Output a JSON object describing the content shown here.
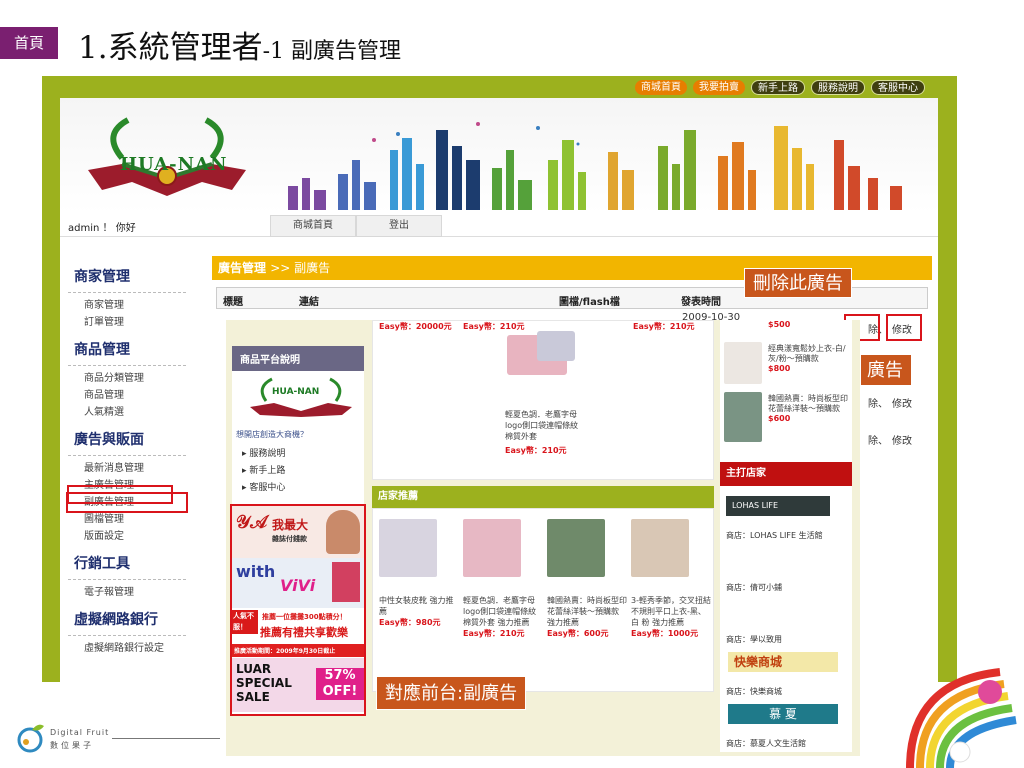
{
  "slide": {
    "home_tag": "首頁",
    "title_main": "1.系統管理者",
    "title_sub": "-1 副廣告管理"
  },
  "topnav": [
    "商城首頁",
    "我要拍賣",
    "新手上路",
    "服務說明",
    "客服中心"
  ],
  "logo_text": "HUA-NAN",
  "login": {
    "greeting": "admin ！ 你好",
    "tabs": [
      "商城首頁",
      "登出"
    ]
  },
  "sidebar": [
    {
      "title": "商家管理",
      "items": [
        "商家管理",
        "訂單管理"
      ]
    },
    {
      "title": "商品管理",
      "items": [
        "商品分類管理",
        "商品管理",
        "人氣精選"
      ]
    },
    {
      "title": "廣告與販面",
      "items": [
        "最新消息管理",
        "主廣告管理",
        "副廣告管理",
        "圖檔管理",
        "版面設定"
      ]
    },
    {
      "title": "行銷工具",
      "items": [
        "電子報管理"
      ]
    },
    {
      "title": "虛擬網路銀行",
      "items": [
        "虛擬網路銀行設定"
      ]
    }
  ],
  "ad_panel": {
    "title": "廣告管理",
    "crumb": ">> 副廣告",
    "columns": [
      "標題",
      "連結",
      "圖檔/flash檔",
      "發表時間"
    ],
    "date_fragment": "2009-10-30",
    "row_actions": [
      "除、",
      "修改",
      "除、",
      "修改",
      "除、",
      "修改"
    ]
  },
  "callouts": {
    "delete": "刪除此廣告",
    "ad_partial": "廣告",
    "front": "對應前台:副廣告"
  },
  "storefront": {
    "sidebar_title": "商品平台說明",
    "sidebar_logo": "HUA-NAN",
    "sidebar_question": "想開店創造大商機？",
    "sidebar_links": [
      "服務說明",
      "新手上路",
      "客服中心"
    ],
    "top_prices": [
      "Easy幣：20000元",
      "Easy幣：210元",
      "Easy幣：210元"
    ],
    "mid_product": {
      "desc": "輕夏色調．老鷹字母 logo側口袋連帽條紋 棉質外套",
      "price": "Easy幣：210元"
    },
    "store_title": "店家推薦",
    "products": [
      {
        "desc": "中性女裝皮靴 強力推薦",
        "price": "Easy幣：980元"
      },
      {
        "desc": "輕夏色調．老鷹字母 logo側口袋連帽條紋 棉質外套 強力推薦",
        "price": "Easy幣：210元"
      },
      {
        "desc": "韓國熱賣：時尚板型印 花蕾絲洋裝～預購款 強力推薦",
        "price": "Easy幣：600元"
      },
      {
        "desc": "3-輕秀季節，交叉扭結 不規則平口上衣-黑、 白 粉 強力推薦",
        "price": "Easy幣：1000元"
      }
    ],
    "right_items": [
      {
        "desc": "",
        "price": "$500"
      },
      {
        "desc": "經典漾寬鬆妙上衣-白/ 灰/粉～預購款",
        "price": "$800"
      },
      {
        "desc": "韓國熱賣：時尚板型印 花蕾絲洋裝～預購款",
        "price": "$600"
      }
    ],
    "shops_title": "主打店家",
    "shops": [
      "商店：LOHAS LIFE 生活館",
      "商店：倩可小鋪",
      "商店：學以致用",
      "商店：快樂商城",
      "商店：慕夏人文生活館"
    ],
    "shop_logos": [
      "LOHAS LIFE",
      "快樂商城",
      "慕 夏"
    ],
    "promo": {
      "p1_big": "我最大",
      "p1_small": "雜誌付錢款",
      "p2_big": "with",
      "p2_vivi": "ViVi",
      "p3_top": "推薦一位攤攤300點積分！",
      "p3_main": "推薦有禮共享歡樂",
      "p3_date": "推廣活動期間：2009年9月30日截止",
      "p3_badge": "人氣不服！",
      "p4_big": "LUAR SPECIAL SALE",
      "p4_off": "57% OFF!"
    }
  },
  "brand": {
    "en": "Digital Fruit",
    "zh": "數位果子"
  },
  "colors": {
    "accent_purple": "#7a1f70",
    "frame_green": "#9cb11e",
    "highlight_red": "#d9141b",
    "callout_orange": "#c8561c",
    "ad_header_gold": "#f2b500"
  }
}
